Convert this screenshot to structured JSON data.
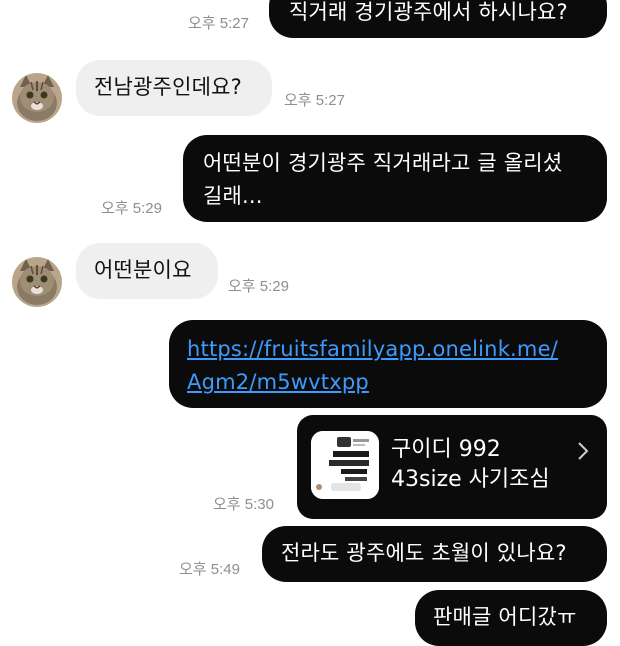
{
  "messages": {
    "m1": {
      "text": "직거래 경기광주에서 하시나요?",
      "time": "오후 5:27"
    },
    "m2": {
      "text": "전남광주인데요?",
      "time": "오후 5:27"
    },
    "m3": {
      "line1": "어떤분이 경기광주 직거래라고 글 올리셨",
      "line2": "길래...",
      "time": "오후 5:29"
    },
    "m4": {
      "text": "어떤분이요",
      "time": "오후 5:29"
    },
    "m5": {
      "line1": "https://fruitsfamilyapp.onelink.me/",
      "line2": "Agm2/m5wvtxpp"
    },
    "m6": {
      "title1": "구이디 992",
      "title2": "43size 사기조심",
      "time": "오후 5:30"
    },
    "m7": {
      "text": "전라도 광주에도 초월이 있나요?",
      "time": "오후 5:49"
    },
    "m8": {
      "text": "판매글 어디갔ㅠ"
    }
  },
  "colors": {
    "outgoing_bubble": "#0b0b0b",
    "incoming_bubble": "#efefef",
    "link": "#3d9bff",
    "timestamp": "#8e8e93"
  },
  "icons": {
    "avatar": "cat-avatar-icon",
    "chevron": "chevron-right-icon"
  }
}
